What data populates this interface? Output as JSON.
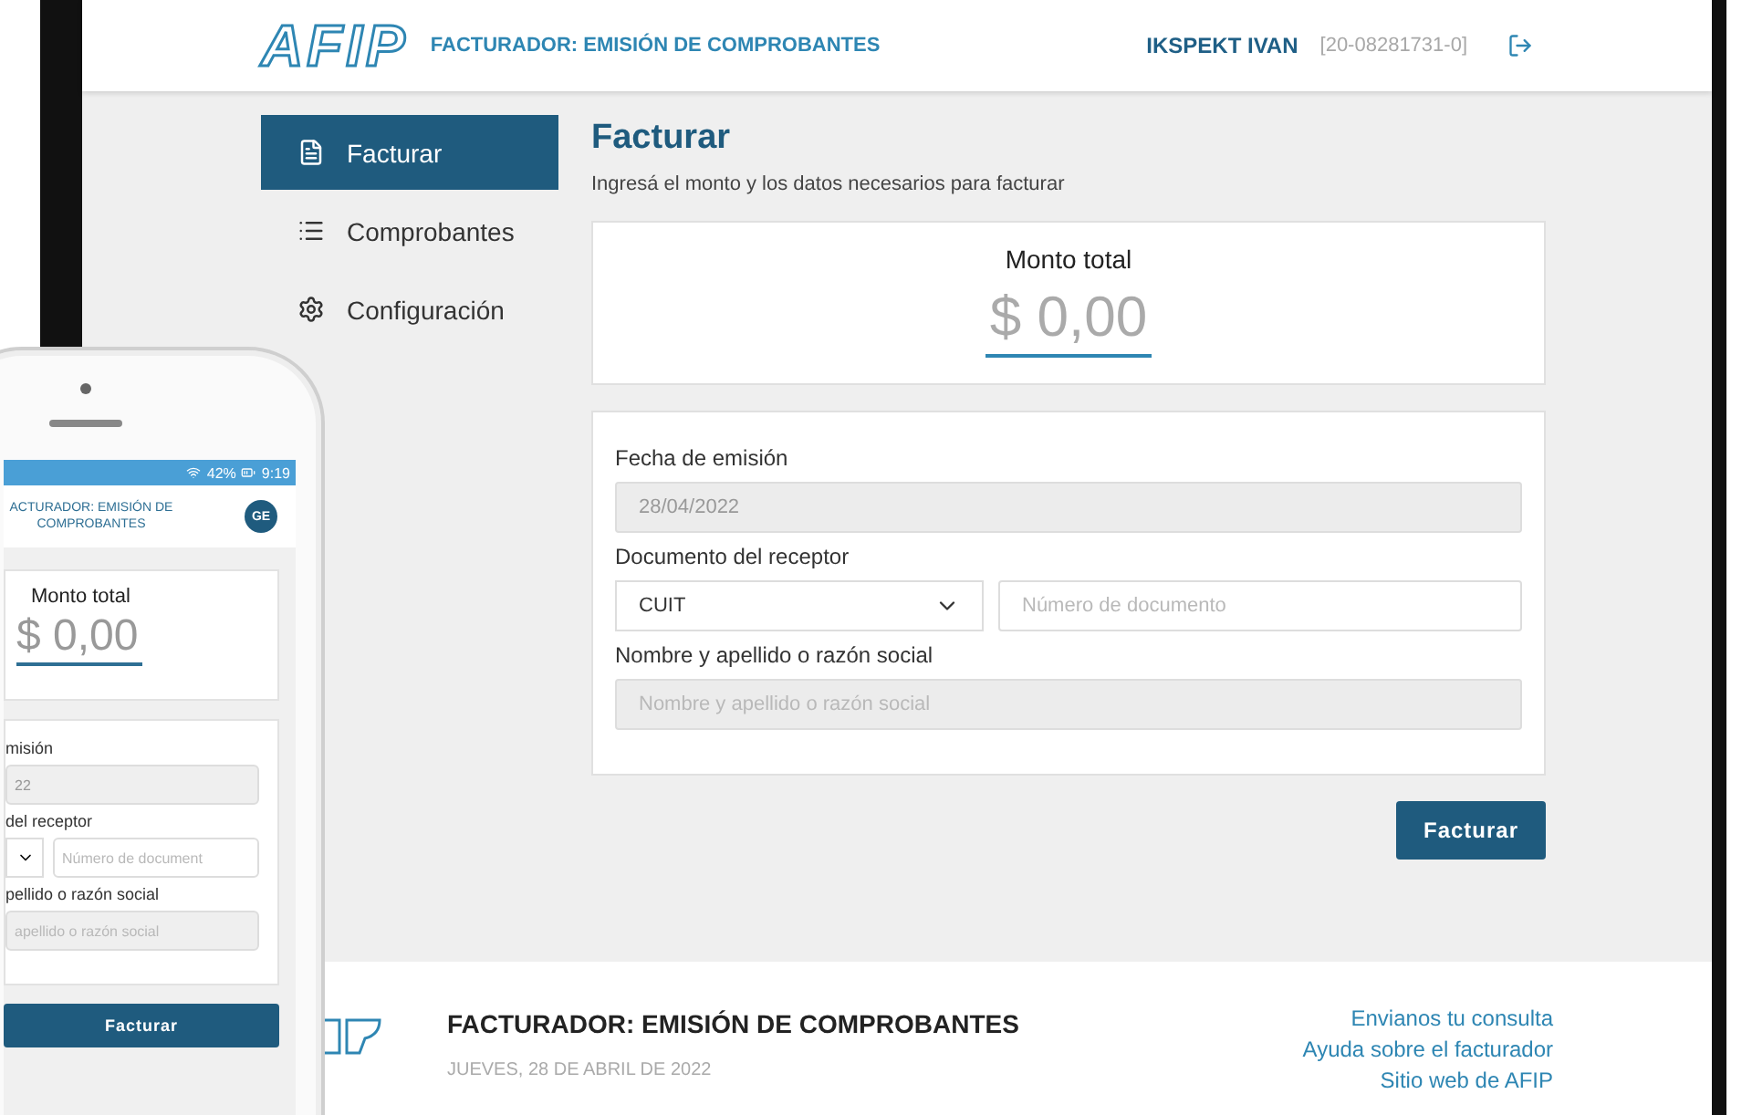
{
  "header": {
    "logo": "AFIP",
    "title": "FACTURADOR: EMISIÓN DE COMPROBANTES",
    "user": "IKSPEKT IVAN",
    "cuit": "[20-08281731-0]"
  },
  "sidebar": {
    "items": [
      {
        "label": "Facturar",
        "selected": true
      },
      {
        "label": "Comprobantes",
        "selected": false
      },
      {
        "label": "Configuración",
        "selected": false
      }
    ]
  },
  "main": {
    "title": "Facturar",
    "subtitle": "Ingresá el monto y los datos necesarios para facturar",
    "amount_label": "Monto total",
    "amount": "$ 0,00",
    "fields": [
      {
        "kind": "text",
        "label": "Fecha de emisión",
        "value": "28/04/2022",
        "disabled": true
      },
      {
        "kind": "document",
        "label": "Documento del receptor",
        "select": "CUIT",
        "placeholder": "Número de documento",
        "disabled": false
      },
      {
        "kind": "text",
        "label": "Nombre y apellido o razón social",
        "placeholder": "Nombre y apellido o razón social",
        "disabled": true
      }
    ],
    "button": "Facturar"
  },
  "footer": {
    "title": "FACTURADOR: EMISIÓN DE COMPROBANTES",
    "date": "JUEVES, 28 DE ABRIL DE 2022",
    "links": [
      "Envianos tu consulta",
      "Ayuda sobre el facturador",
      "Sitio web de AFIP"
    ]
  },
  "phone": {
    "battery": "42%",
    "time": "9:19",
    "title": "ACTURADOR: EMISIÓN DE COMPROBANTES",
    "avatar": "GE",
    "amount_label": "Monto total",
    "amount": "$ 0,00",
    "fields": [
      {
        "kind": "text",
        "label": "misión",
        "value": "22"
      },
      {
        "kind": "document",
        "label": "del receptor",
        "placeholder": "Número de document"
      },
      {
        "kind": "text",
        "label": "pellido o razón social",
        "placeholder": "apellido o razón social"
      }
    ],
    "button": "Facturar"
  }
}
